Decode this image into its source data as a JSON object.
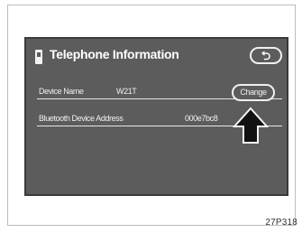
{
  "screen": {
    "title": "Telephone Information",
    "back_label": "⮌",
    "device_name_label": "Device Name",
    "device_name_value": "W21T",
    "bt_address_label": "Bluetooth Device Address",
    "bt_address_value": "000e7bc8",
    "change_label": "Change"
  },
  "figure": {
    "code": "27P318"
  },
  "colors": {
    "screen_bg": "#5c5c5c",
    "text": "#f0f0f0"
  }
}
